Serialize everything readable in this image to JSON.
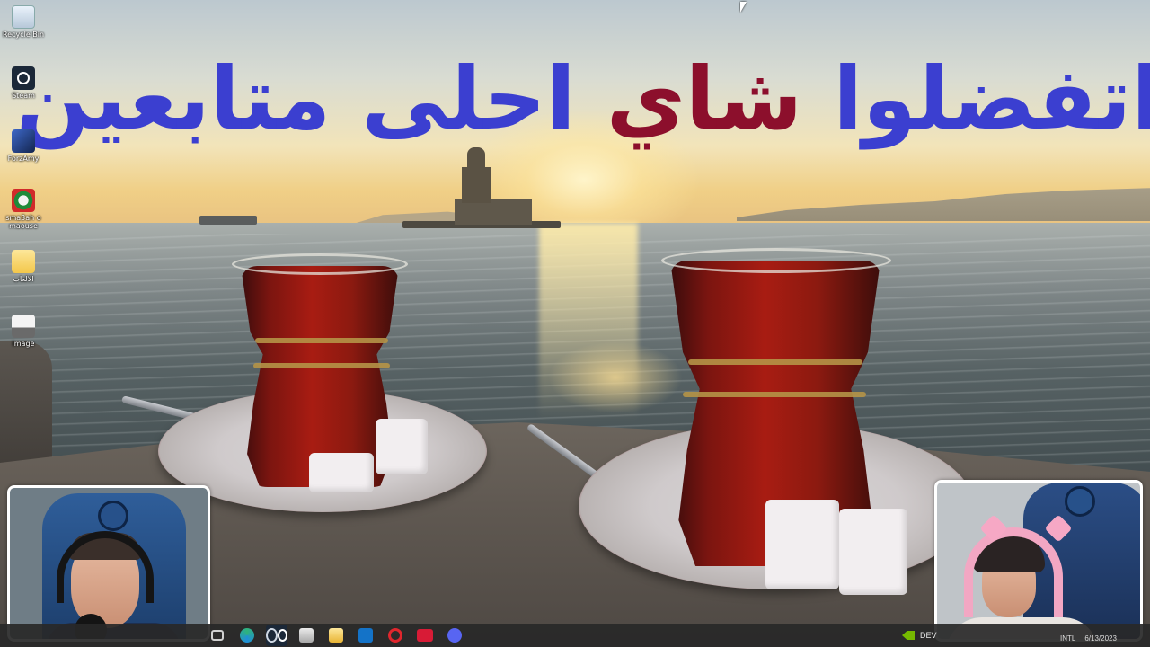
{
  "desktop": {
    "icons": [
      {
        "label": "Recycle Bin",
        "icon": "recycle-bin-icon"
      },
      {
        "label": "Steam",
        "icon": "steam-icon"
      },
      {
        "label": "ForzAmy",
        "icon": "forza-game-icon"
      },
      {
        "label": "sma3ah o maouse",
        "icon": "mouse-app-icon"
      },
      {
        "label": "الالعاب",
        "icon": "folder-icon"
      },
      {
        "label": "image",
        "icon": "image-file-icon"
      }
    ]
  },
  "overlay": {
    "title_words": [
      "اتفضلوا",
      "شاي",
      "احلى",
      "متابعين"
    ],
    "colors": {
      "blue": "#3b3fd0",
      "red": "#8c0f2c"
    }
  },
  "taskbar": {
    "apps": [
      {
        "name": "task-view",
        "icon": "task-view-icon"
      },
      {
        "name": "edge",
        "icon": "edge-browser-icon"
      },
      {
        "name": "steam",
        "icon": "steam-icon"
      },
      {
        "name": "microsoft-store",
        "icon": "store-icon"
      },
      {
        "name": "file-explorer",
        "icon": "folder-icon"
      },
      {
        "name": "outlook",
        "icon": "outlook-icon"
      },
      {
        "name": "opera-gx",
        "icon": "opera-icon"
      },
      {
        "name": "voicemod",
        "icon": "voicemod-icon"
      },
      {
        "name": "discord",
        "icon": "discord-icon"
      }
    ],
    "tray_text": "DEV",
    "clock_time": "INTL",
    "clock_date": "6/13/2023"
  }
}
